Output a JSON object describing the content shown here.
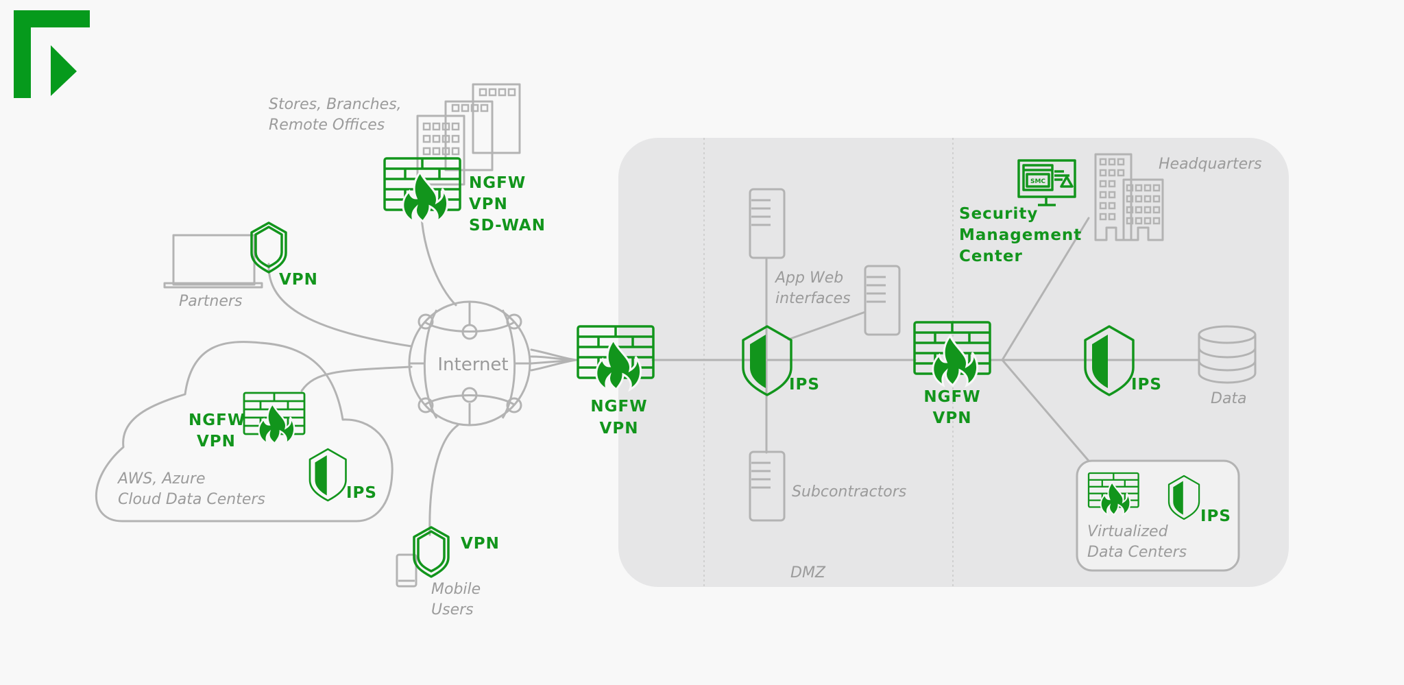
{
  "colors": {
    "brand_green": "#12951c",
    "line_gray": "#b3b3b3",
    "text_gray": "#9b9b9b",
    "background": "#f8f8f8",
    "zone_bg": "#e6e6e7"
  },
  "logo": {
    "icon": "brand-logo"
  },
  "internet": {
    "label": "Internet"
  },
  "nodes": {
    "branches": {
      "label_lines": [
        "Stores, Branches,",
        "Remote Offices"
      ],
      "features": [
        "NGFW",
        "VPN",
        "SD-WAN"
      ]
    },
    "partners": {
      "label": "Partners",
      "features": [
        "VPN"
      ]
    },
    "cloud": {
      "label_lines": [
        "AWS, Azure",
        "Cloud Data Centers"
      ],
      "fw_features": [
        "NGFW",
        "VPN"
      ],
      "ips_label": "IPS"
    },
    "mobile": {
      "label_lines": [
        "Mobile",
        "Users"
      ],
      "features": [
        "VPN"
      ]
    },
    "edge_fw": {
      "features": [
        "NGFW",
        "VPN"
      ]
    },
    "dmz": {
      "zone_label": "DMZ",
      "ips_label": "IPS",
      "app_web_lines": [
        "App Web",
        "interfaces"
      ],
      "subcontractors": "Subcontractors"
    },
    "internal_fw": {
      "features": [
        "NGFW",
        "VPN"
      ]
    },
    "smc": {
      "label_lines": [
        "Security",
        "Management",
        "Center"
      ],
      "screen_text": "SMC"
    },
    "headquarters": {
      "label": "Headquarters"
    },
    "data": {
      "label": "Data",
      "ips_label": "IPS"
    },
    "virtualized": {
      "label_lines": [
        "Virtualized",
        "Data Centers"
      ],
      "ips_label": "IPS"
    }
  }
}
